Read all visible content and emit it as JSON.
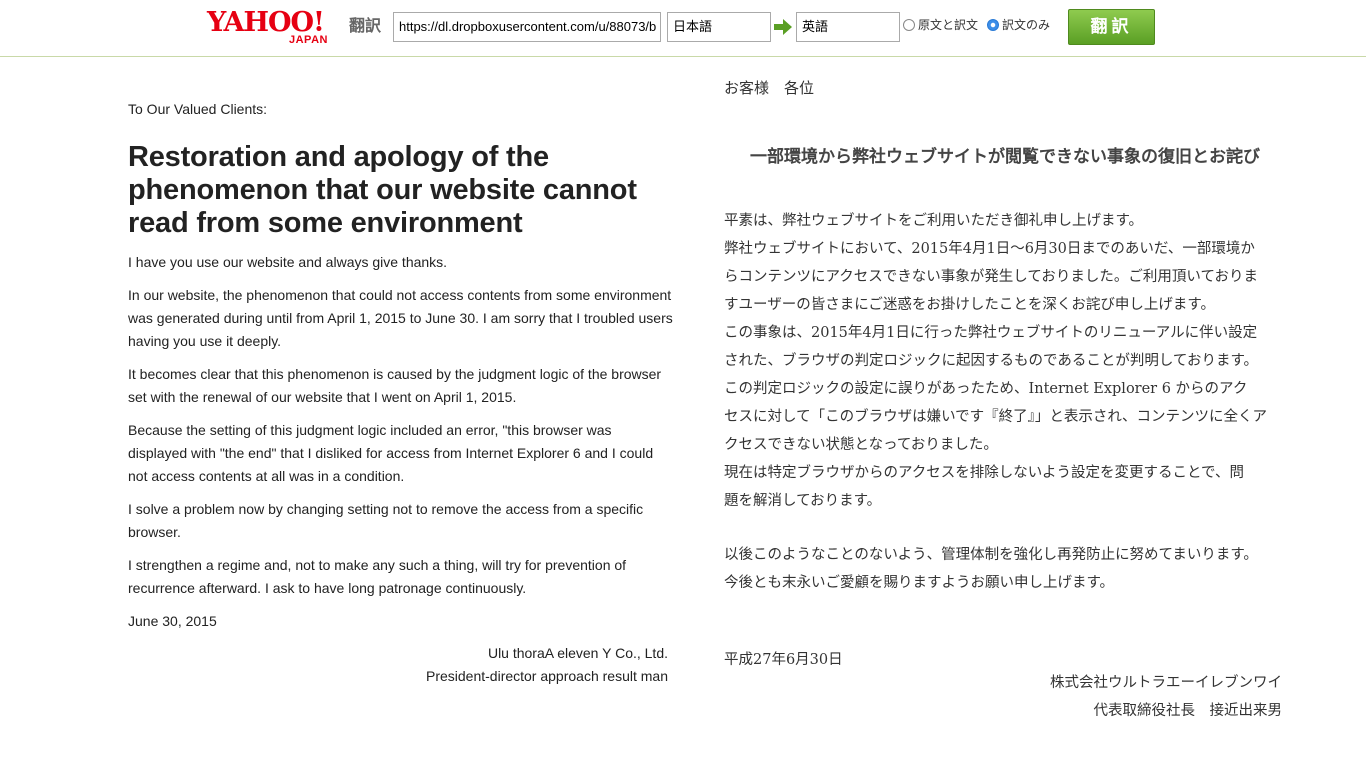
{
  "toolbar": {
    "logo_text": "YAHOO!",
    "logo_sub": "JAPAN",
    "service_name": "翻訳",
    "url_value": "https://dl.dropboxusercontent.com/u/88073/b",
    "source_language": "日本語",
    "target_language": "英語",
    "option_both": "原文と訳文",
    "option_translation_only": "訳文のみ",
    "selected_option": "訳文のみ",
    "translate_button": "翻訳",
    "accent_color": "#5a9f24"
  },
  "english": {
    "greeting": "To Our Valued Clients:",
    "title": "Restoration and apology of the phenomenon that our website cannot read from some environment",
    "paragraphs": [
      "I have you use our website and always give thanks.",
      "In our website, the phenomenon that could not access contents from some environment was generated during until from April 1, 2015 to June 30. I am sorry that I troubled users having you use it deeply.",
      "It becomes clear that this phenomenon is caused by the judgment logic of the browser set with the renewal of our website that I went on April 1, 2015.",
      "Because the setting of this judgment logic included an error, \"this browser was displayed with \"the end\" that I disliked for access from Internet Explorer 6 and I could not access contents at all was in a condition.",
      "I solve a problem now by changing setting not to remove the access from a specific browser.",
      "I strengthen a regime and, not to make any such a thing, will try for prevention of recurrence afterward. I ask to have long patronage continuously."
    ],
    "date": "June 30, 2015",
    "company": "Ulu thoraA eleven Y Co., Ltd.",
    "president": "President-director approach result man"
  },
  "japanese": {
    "greeting": "お客様　各位",
    "title": "一部環境から弊社ウェブサイトが閲覧できない事象の復旧とお詫び",
    "lines": [
      "平素は、弊社ウェブサイトをご利用いただき御礼申し上げます。",
      "弊社ウェブサイトにおいて、2015年4月1日～6月30日までのあいだ、一部環境か",
      "らコンテンツにアクセスできない事象が発生しておりました。ご利用頂いておりま",
      "すユーザーの皆さまにご迷惑をお掛けしたことを深くお詫び申し上げます。",
      "この事象は、2015年4月1日に行った弊社ウェブサイトのリニューアルに伴い設定",
      "された、ブラウザの判定ロジックに起因するものであることが判明しております。",
      "この判定ロジックの設定に誤りがあったため、Internet Explorer 6 からのアク",
      "セスに対して「このブラウザは嫌いです『終了』」と表示され、コンテンツに全くア",
      "クセスできない状態となっておりました。",
      "現在は特定ブラウザからのアクセスを排除しないよう設定を変更することで、問",
      "題を解消しております。"
    ],
    "closing_lines": [
      "以後このようなことのないよう、管理体制を強化し再発防止に努めてまいります。",
      "今後とも末永いご愛顧を賜りますようお願い申し上げます。"
    ],
    "date": "平成27年6月30日",
    "company": "株式会社ウルトラエーイレブンワイ",
    "president": "代表取締役社長　接近出来男"
  }
}
